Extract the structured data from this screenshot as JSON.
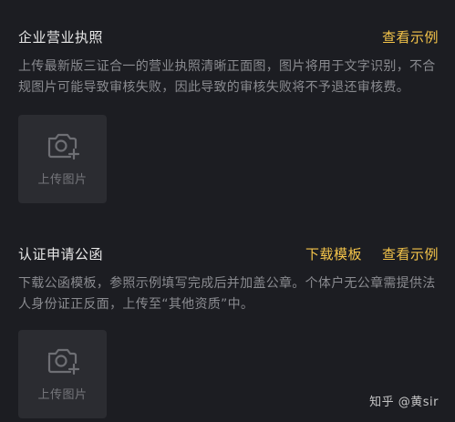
{
  "license_section": {
    "title": "企业营业执照",
    "view_example": "查看示例",
    "description": "上传最新版三证合一的营业执照清晰正面图，图片将用于文字识别，不合规图片可能导致审核失败，因此导致的审核失败将不予退还审核费。",
    "upload_label": "上传图片",
    "upload_icon": "camera-plus-icon"
  },
  "letter_section": {
    "title": "认证申请公函",
    "download_template": "下载模板",
    "view_example": "查看示例",
    "description": "下载公函模板，参照示例填写完成后并加盖公章。个体户无公章需提供法人身份证正反面，上传至“其他资质”中。",
    "upload_label": "上传图片",
    "upload_icon": "camera-plus-icon"
  },
  "watermark": "知乎 @黄sir",
  "colors": {
    "background": "#1c1d22",
    "accent": "#f4c44a",
    "muted_text": "#8a8b90",
    "upload_box": "#2b2c31"
  }
}
